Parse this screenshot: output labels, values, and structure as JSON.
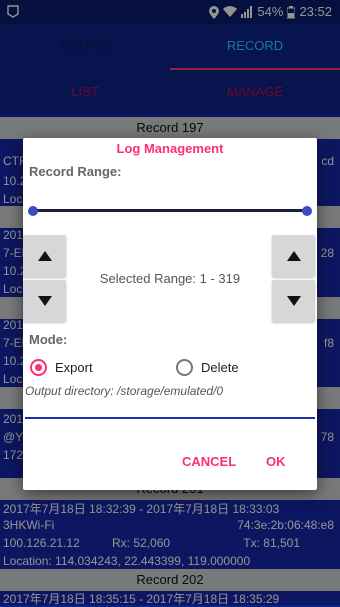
{
  "status_bar": {
    "battery": "54%",
    "time": "23:52",
    "icons": [
      "app-icon",
      "location-icon",
      "wifi-icon",
      "signal-icon",
      "battery-icon"
    ]
  },
  "tabs": [
    {
      "label": "CONFIG",
      "active": false
    },
    {
      "label": "RECORD",
      "active": true
    }
  ],
  "subtabs": [
    {
      "label": "LIST"
    },
    {
      "label": "MANAGE"
    }
  ],
  "records": {
    "header_197": "Record 197",
    "header_201": "Record 201",
    "header_202": "Record 202",
    "r197_line1": "CTF",
    "r197_line1_right": "cd",
    "r197_line2": "10.2",
    "r197_line3": "Loca",
    "r198_line1": "201",
    "r198_line2": "7-El",
    "r198_right": "28",
    "r198_line3": "10.2",
    "r198_line4": "Loca",
    "r199_line1": "201",
    "r199_line2": "7-El",
    "r199_right": "f8",
    "r199_line3": "10.2",
    "r199_line4": "Loca",
    "r200_line1": "201",
    "r200_line2": "@YC",
    "r200_right": "78",
    "r200_line3": "172",
    "r201_time": "2017年7月18日 18:32:39 - 2017年7月18日 18:33:03",
    "r201_ssid": "3HKWi-Fi",
    "r201_mac": "74:3e:2b:06:48:e8",
    "r201_ip": "100.126.21.12",
    "r201_rx": "Rx: 52,060",
    "r201_tx": "Tx: 81,501",
    "r201_location": "Location: 114.034243, 22.443399, 119.000000",
    "r202_time": "2017年7月18日 18:35:15 - 2017年7月18日 18:35:29"
  },
  "dialog": {
    "title": "Log Management",
    "range_label": "Record Range:",
    "range_start": 1,
    "range_end": 319,
    "selected_range_text": "Selected Range: 1 - 319",
    "mode_label": "Mode:",
    "mode_options": [
      {
        "label": "Export",
        "selected": true
      },
      {
        "label": "Delete",
        "selected": false
      }
    ],
    "output_directory": "Output directory: /storage/emulated/0",
    "cancel_label": "CANCEL",
    "ok_label": "OK"
  },
  "colors": {
    "accent": "#ff2e73",
    "tab_active": "#2fd3f5",
    "list_bg": "#1729a7",
    "header_bg": "#0d2386"
  }
}
